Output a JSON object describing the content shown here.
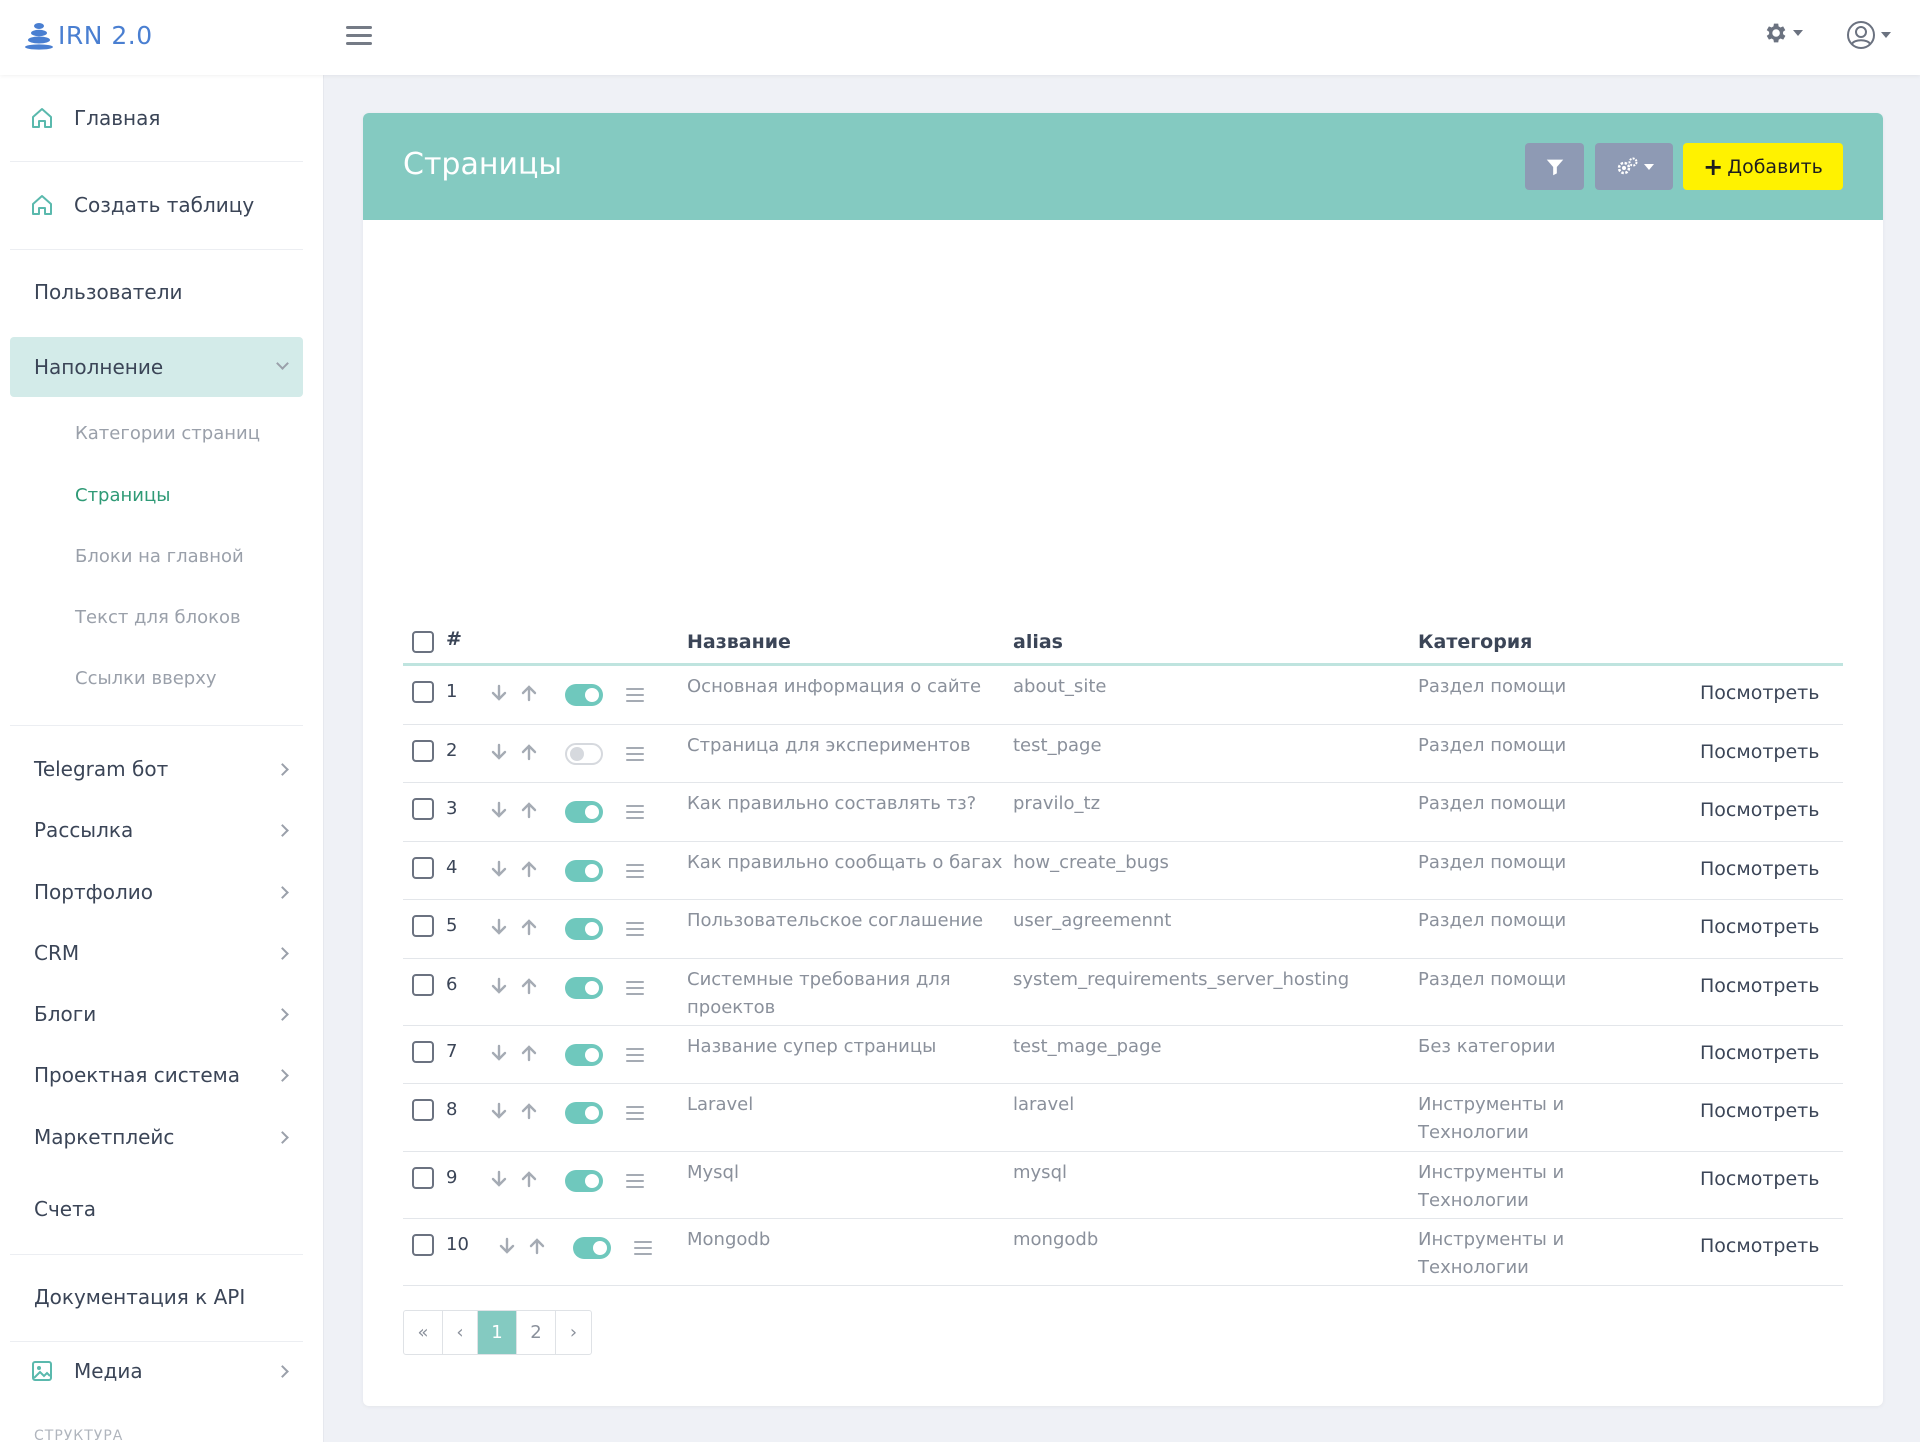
{
  "app": {
    "logo_text": "IRN 2.0"
  },
  "topbar": {
    "menu_icon": "hamburger-icon",
    "settings_icon": "gear-icon",
    "user_icon": "user-circle-icon"
  },
  "sidebar": {
    "items": [
      {
        "label": "Главная",
        "icon": "home-icon"
      },
      {
        "label": "Создать таблицу",
        "icon": "home-icon"
      },
      {
        "label": "Пользователи"
      },
      {
        "label": "Наполнение",
        "expanded": true
      },
      {
        "label": "Telegram бот"
      },
      {
        "label": "Рассылка"
      },
      {
        "label": "Портфолио"
      },
      {
        "label": "CRM"
      },
      {
        "label": "Блоги"
      },
      {
        "label": "Проектная система"
      },
      {
        "label": "Маркетплейс"
      },
      {
        "label": "Счета"
      },
      {
        "label": "Документация к API"
      },
      {
        "label": "Медиа",
        "icon": "image-icon"
      }
    ],
    "subitems": [
      {
        "label": "Категории страниц"
      },
      {
        "label": "Страницы",
        "current": true
      },
      {
        "label": "Блоки на главной"
      },
      {
        "label": "Текст для блоков"
      },
      {
        "label": "Ссылки вверху"
      }
    ],
    "section_label": "СТРУКТУРА"
  },
  "page": {
    "title": "Страницы",
    "add_button": "Добавить",
    "filter_icon": "filter-icon",
    "settings_icon": "gears-icon"
  },
  "table": {
    "headers": {
      "num": "#",
      "name": "Название",
      "alias": "alias",
      "category": "Категория"
    },
    "view_label": "Посмотреть",
    "rows": [
      {
        "id": "1",
        "name": "Основная информация о сайте",
        "alias": "about_site",
        "category": "Раздел помощи",
        "enabled": true
      },
      {
        "id": "2",
        "name": "Страница для экспериментов",
        "alias": "test_page",
        "category": "Раздел помощи",
        "enabled": false
      },
      {
        "id": "3",
        "name": "Как правильно составлять тз?",
        "alias": "pravilo_tz",
        "category": "Раздел помощи",
        "enabled": true
      },
      {
        "id": "4",
        "name": "Как правильно сообщать о багах",
        "alias": "how_create_bugs",
        "category": "Раздел помощи",
        "enabled": true
      },
      {
        "id": "5",
        "name": "Пользовательское соглашение",
        "alias": "user_agreemennt",
        "category": "Раздел помощи",
        "enabled": true
      },
      {
        "id": "6",
        "name": "Системные требования для проектов",
        "alias": "system_requirements_server_hosting",
        "category": "Раздел помощи",
        "enabled": true
      },
      {
        "id": "7",
        "name": "Название супер страницы",
        "alias": "test_mage_page",
        "category": "Без категории",
        "enabled": true
      },
      {
        "id": "8",
        "name": "Laravel",
        "alias": "laravel",
        "category": "Инструменты и Технологии",
        "enabled": true
      },
      {
        "id": "9",
        "name": "Mysql",
        "alias": "mysql",
        "category": "Инструменты и Технологии",
        "enabled": true
      },
      {
        "id": "10",
        "name": "Mongodb",
        "alias": "mongodb",
        "category": "Инструменты и Технологии",
        "enabled": true
      }
    ]
  },
  "pagination": {
    "first": "«",
    "prev": "‹",
    "pages": [
      "1",
      "2"
    ],
    "current": "1",
    "next": "›"
  }
}
